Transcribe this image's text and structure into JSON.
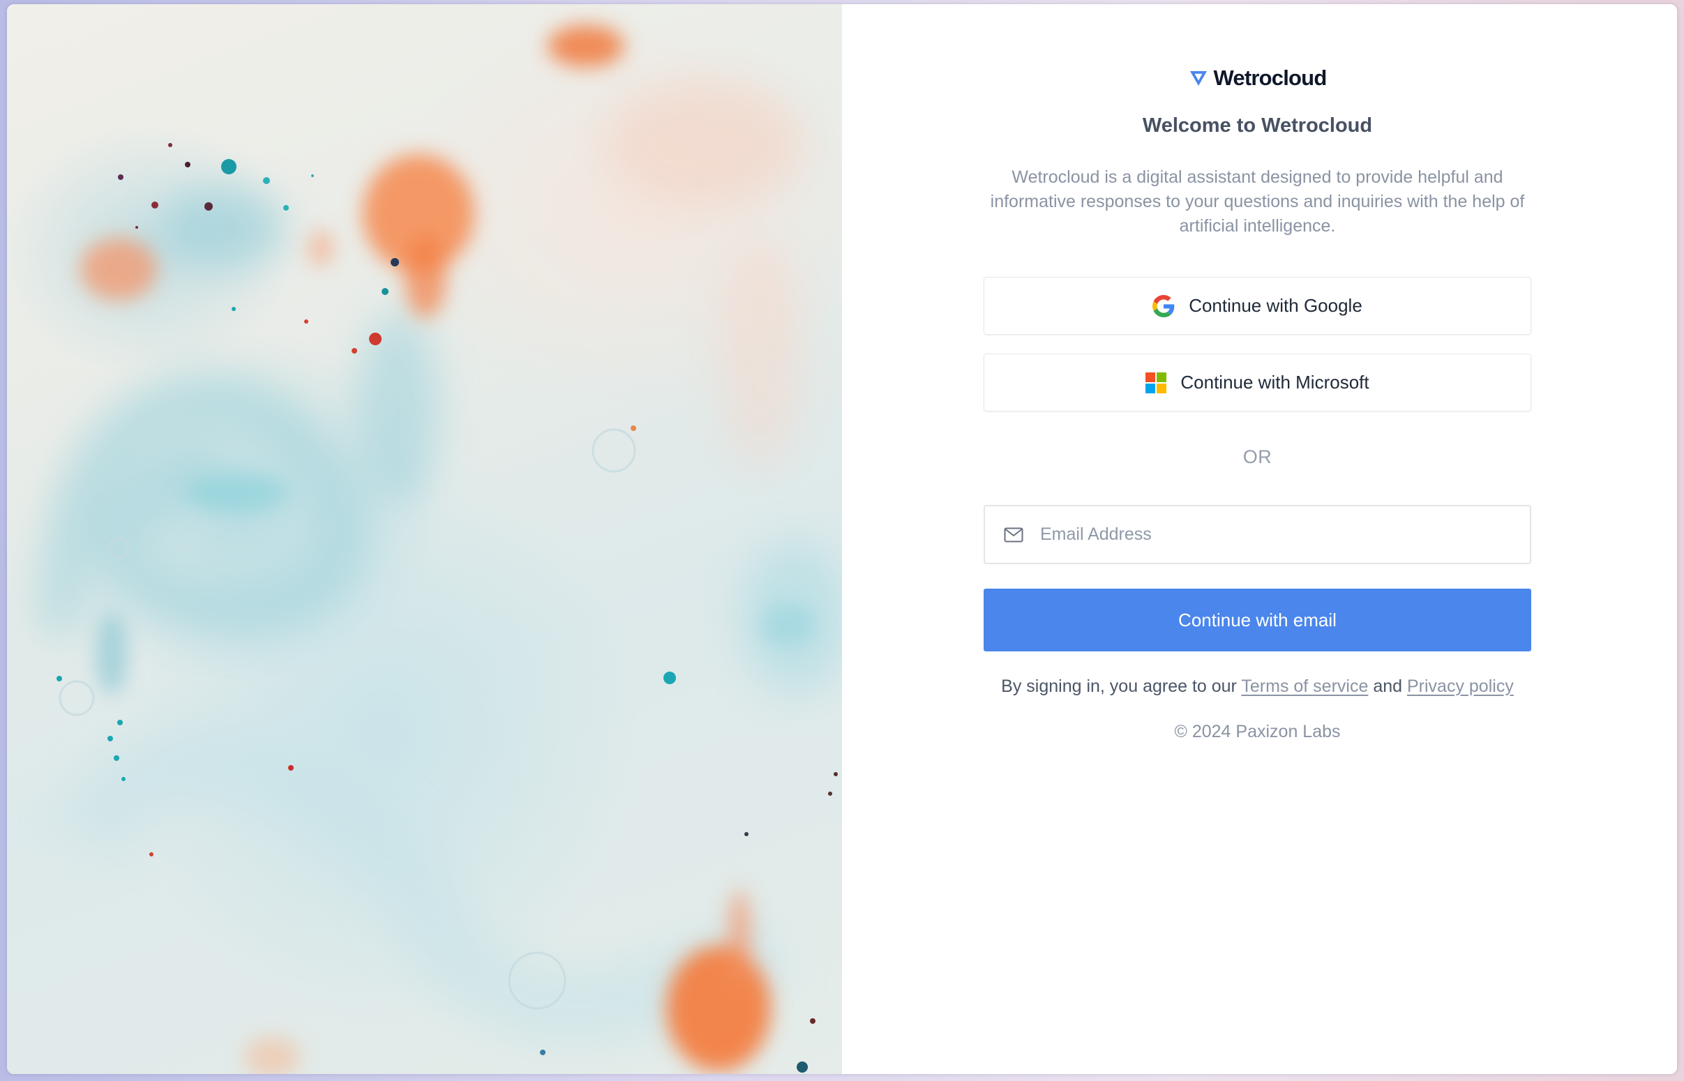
{
  "brand": {
    "name": "Wetrocloud",
    "logo_icon": "triangle-logo-icon",
    "accent": "#4a86ec"
  },
  "heading": "Welcome to Wetrocloud",
  "description": "Wetrocloud is a digital assistant designed to provide helpful and informative responses to your questions and inquiries with the help of artificial intelligence.",
  "sso": {
    "google_label": "Continue with Google",
    "google_icon": "google-icon",
    "microsoft_label": "Continue with Microsoft",
    "microsoft_icon": "microsoft-icon"
  },
  "divider": "OR",
  "email": {
    "icon": "mail-icon",
    "placeholder": "Email Address",
    "value": ""
  },
  "primary_button": "Continue with email",
  "legal": {
    "prefix": "By signing in, you agree to our",
    "terms_label": "Terms of service",
    "joiner": "and",
    "privacy_label": "Privacy policy"
  },
  "copyright": "© 2024 Paxizon Labs"
}
